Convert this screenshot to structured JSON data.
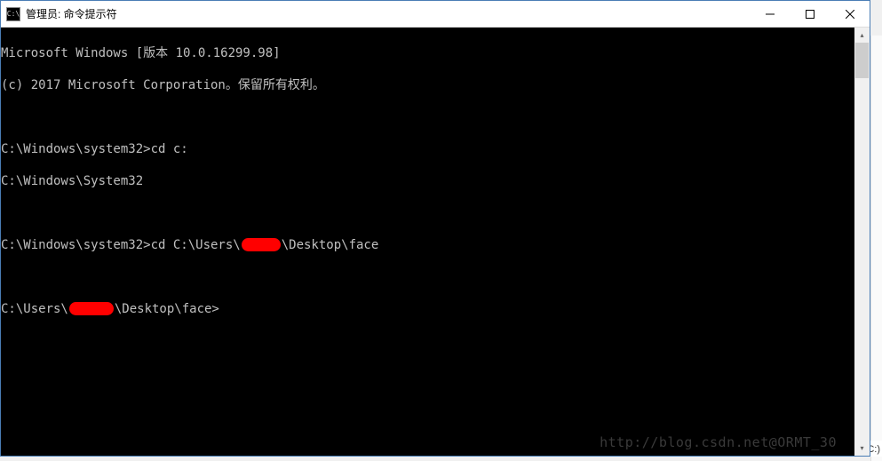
{
  "window": {
    "title": "管理员: 命令提示符",
    "icon_label": "C:\\"
  },
  "terminal": {
    "line1": "Microsoft Windows [版本 10.0.16299.98]",
    "line2": "(c) 2017 Microsoft Corporation。保留所有权利。",
    "line4": "C:\\Windows\\system32>cd c:",
    "line5": "C:\\Windows\\System32",
    "line7_pre": "C:\\Windows\\system32>cd C:\\Users\\",
    "line7_post": "\\Desktop\\face",
    "line9_pre": "C:\\Users\\",
    "line9_post": "\\Desktop\\face>"
  },
  "watermark": "http://blog.csdn.net@ORMT_30",
  "bg_text": "本地磁盘 (C:)"
}
